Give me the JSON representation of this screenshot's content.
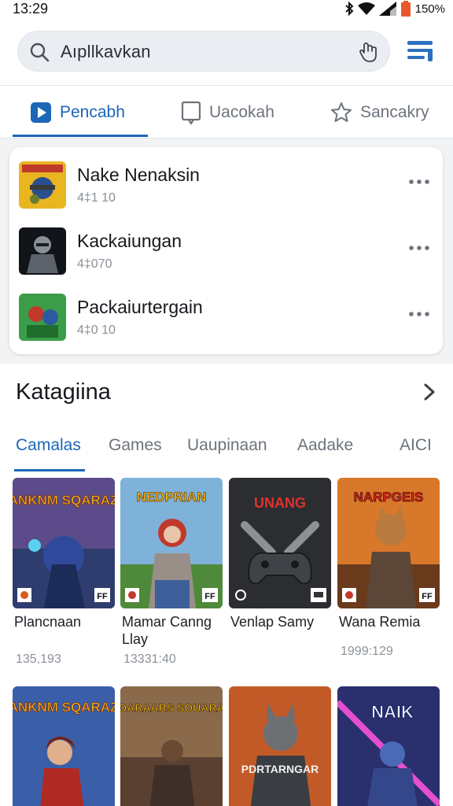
{
  "status": {
    "time": "13:29",
    "battery": "150%"
  },
  "search": {
    "text": "Aıpllkavkan"
  },
  "tabs": [
    {
      "label": "Pencabh",
      "icon": "play-icon",
      "active": true
    },
    {
      "label": "Uacokah",
      "icon": "tablet-icon",
      "active": false
    },
    {
      "label": "Sancakry",
      "icon": "star-icon",
      "active": false
    }
  ],
  "recent": [
    {
      "name": "Nake Nenaksin",
      "size": "4‡1 10"
    },
    {
      "name": "Kackaiungan",
      "size": "4‡070"
    },
    {
      "name": "Packaiurtergain",
      "size": "4‡0 10"
    }
  ],
  "categories": {
    "title": "Katagiina",
    "tabs": [
      "Camalas",
      "Games",
      "Uaupinaan",
      "Aadake",
      "AICI"
    ],
    "active_tab": "Camalas"
  },
  "games_row1": [
    {
      "art_title": "SUANKNM SQARAZAN",
      "name": "Plancnaan",
      "count": "135,193"
    },
    {
      "art_title": "NEDPRIAN",
      "name": "Mamar Canng Llay",
      "count": "13331:40"
    },
    {
      "art_title": "UNANG",
      "name": "Venlap Samy",
      "count": ""
    },
    {
      "art_title": "NARPGEIS",
      "name": "Wana Remia",
      "count": "1999:129"
    }
  ],
  "games_row2": [
    {
      "art_title": "SUANKNM SQARAZAN"
    },
    {
      "art_title": "SOARAARS SOUARAS"
    },
    {
      "art_title": "PDRTARNGAR"
    },
    {
      "art_title": "NAIK"
    }
  ],
  "colors": {
    "accent": "#1c66b8",
    "background": "#f2f3f5"
  }
}
